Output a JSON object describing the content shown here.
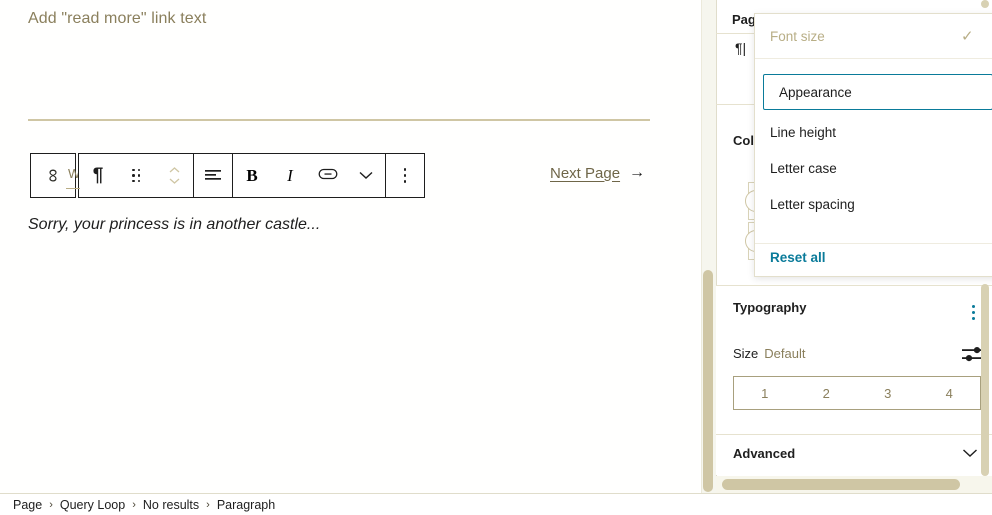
{
  "canvas": {
    "read_more_placeholder": "Add \"read more\" link text",
    "paragraph_text": "Sorry, your princess is in another castle...",
    "next_page_label": "Next Page",
    "next_page_arrow": "→",
    "ghost_letter": "W"
  },
  "toolbar": {
    "parent_block_icon": "chain-link-icon",
    "block_type_icon": "paragraph-pilcrow-icon",
    "drag_icon": "drag-handle-icon",
    "move_icon": "move-up-down-icon",
    "align_icon": "align-text-icon",
    "bold_label": "B",
    "italic_label": "I",
    "link_icon": "link-icon",
    "more_formats_icon": "chevron-down-icon",
    "options_icon": "more-options-vertical-dots-icon"
  },
  "menu": {
    "header_label": "Font size",
    "header_check": "✓",
    "items": [
      {
        "label": "Appearance",
        "selected": true
      },
      {
        "label": "Line height",
        "selected": false
      },
      {
        "label": "Letter case",
        "selected": false
      },
      {
        "label": "Letter spacing",
        "selected": false
      }
    ],
    "reset_label": "Reset all"
  },
  "sidebar": {
    "clipped_page_label": "Page",
    "clipped_pilcrow": "¶|",
    "clipped_color_label": "Col",
    "typography": {
      "title": "Typography",
      "options_icon": "more-options-vertical-dots-icon",
      "size_label": "Size",
      "size_value": "Default",
      "custom_size_icon": "settings-sliders-icon",
      "size_steps": [
        "1",
        "2",
        "3",
        "4"
      ]
    },
    "advanced": {
      "title": "Advanced",
      "chevron_icon": "chevron-down-icon"
    }
  },
  "breadcrumb": {
    "separator": "›",
    "items": [
      "Page",
      "Query Loop",
      "No results",
      "Paragraph"
    ]
  },
  "colors": {
    "accent_teal": "#0a7b9a",
    "muted_olive": "#8a7f5c",
    "border_tan": "#cfc6a4",
    "text_dark": "#1e1e1e"
  }
}
